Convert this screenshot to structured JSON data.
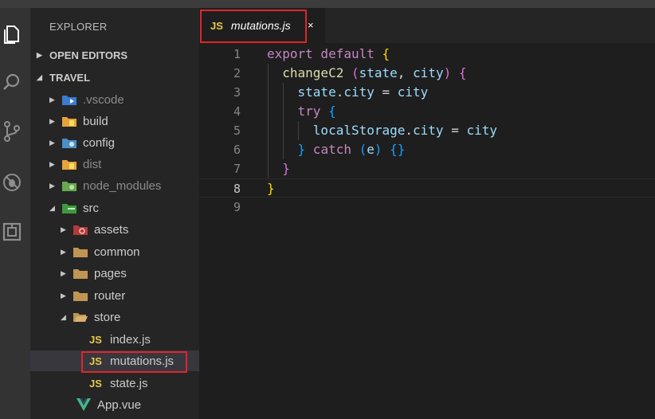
{
  "explorer": {
    "title": "EXPLORER",
    "sections": [
      {
        "label": "OPEN EDITORS",
        "expanded": false
      },
      {
        "label": "TRAVEL",
        "expanded": true
      }
    ],
    "tree": [
      {
        "label": ".vscode",
        "type": "folder",
        "icon": "vscode-folder-icon",
        "dim": true
      },
      {
        "label": "build",
        "type": "folder",
        "icon": "build-folder-icon",
        "dim": false
      },
      {
        "label": "config",
        "type": "folder",
        "icon": "config-folder-icon",
        "dim": false
      },
      {
        "label": "dist",
        "type": "folder",
        "icon": "dist-folder-icon",
        "dim": true
      },
      {
        "label": "node_modules",
        "type": "folder",
        "icon": "node-modules-folder-icon",
        "dim": true
      },
      {
        "label": "src",
        "type": "folder",
        "icon": "src-folder-icon",
        "expanded": true
      },
      {
        "label": "assets",
        "type": "folder",
        "icon": "assets-folder-icon"
      },
      {
        "label": "common",
        "type": "folder",
        "icon": "folder-icon"
      },
      {
        "label": "pages",
        "type": "folder",
        "icon": "folder-icon"
      },
      {
        "label": "router",
        "type": "folder",
        "icon": "folder-icon"
      },
      {
        "label": "store",
        "type": "folder",
        "icon": "folder-open-icon",
        "expanded": true
      },
      {
        "label": "index.js",
        "type": "file",
        "icon": "js-icon",
        "badge": "JS"
      },
      {
        "label": "mutations.js",
        "type": "file",
        "icon": "js-icon",
        "badge": "JS",
        "selected": true
      },
      {
        "label": "state.js",
        "type": "file",
        "icon": "js-icon",
        "badge": "JS"
      },
      {
        "label": "App.vue",
        "type": "file",
        "icon": "vue-icon"
      }
    ]
  },
  "editor": {
    "tab": {
      "badge": "JS",
      "name": "mutations.js",
      "close": "×"
    },
    "line_numbers": [
      "1",
      "2",
      "3",
      "4",
      "5",
      "6",
      "7",
      "8",
      "9"
    ],
    "active_line": "8",
    "lines": [
      [
        {
          "t": "export default ",
          "c": "kw"
        },
        {
          "t": "{",
          "c": "br"
        }
      ],
      [
        {
          "t": "  "
        },
        {
          "t": "changeC2 ",
          "c": "fn"
        },
        {
          "t": "(",
          "c": "br2"
        },
        {
          "t": "state",
          "c": "var"
        },
        {
          "t": ", ",
          "c": "plain"
        },
        {
          "t": "city",
          "c": "var"
        },
        {
          "t": ") ",
          "c": "br2"
        },
        {
          "t": "{",
          "c": "br2"
        }
      ],
      [
        {
          "t": "    "
        },
        {
          "t": "state",
          "c": "var"
        },
        {
          "t": ".",
          "c": "plain"
        },
        {
          "t": "city",
          "c": "var"
        },
        {
          "t": " = ",
          "c": "plain"
        },
        {
          "t": "city",
          "c": "var"
        }
      ],
      [
        {
          "t": "    "
        },
        {
          "t": "try ",
          "c": "kw"
        },
        {
          "t": "{",
          "c": "br3"
        }
      ],
      [
        {
          "t": "      "
        },
        {
          "t": "localStorage",
          "c": "var"
        },
        {
          "t": ".",
          "c": "plain"
        },
        {
          "t": "city",
          "c": "var"
        },
        {
          "t": " = ",
          "c": "plain"
        },
        {
          "t": "city",
          "c": "var"
        }
      ],
      [
        {
          "t": "    "
        },
        {
          "t": "}",
          "c": "br3"
        },
        {
          "t": " catch ",
          "c": "kw"
        },
        {
          "t": "(",
          "c": "br3"
        },
        {
          "t": "e",
          "c": "var"
        },
        {
          "t": ") ",
          "c": "br3"
        },
        {
          "t": "{}",
          "c": "br3"
        }
      ],
      [
        {
          "t": "  "
        },
        {
          "t": "}",
          "c": "br2"
        }
      ],
      [
        {
          "t": "}",
          "c": "br"
        }
      ],
      []
    ]
  },
  "colors": {
    "highlight_box": "#e0252b",
    "js_badge": "#e6c84d",
    "keyword": "#c586c0",
    "variable": "#9cdcfe",
    "function": "#dcdcaa"
  }
}
